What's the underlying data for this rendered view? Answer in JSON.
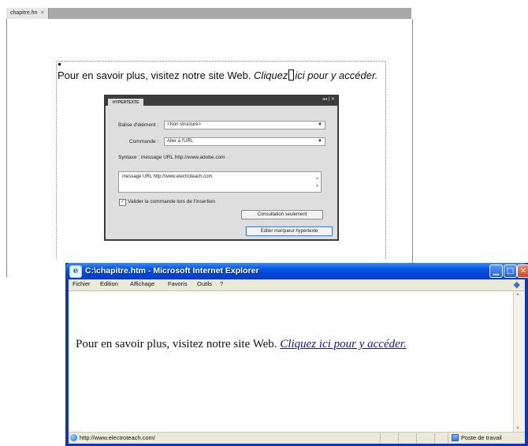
{
  "framemaker": {
    "tab_label": "chapitre.fm",
    "tab_close": "×",
    "sentence_plain": "Pour en savoir plus, visitez notre site Web. ",
    "link_part1": "Cliquez",
    "link_part2": "ici pour y accéder."
  },
  "hypertext_dialog": {
    "tab_label": "HYPERTEXTE",
    "header_controls": "◂◂ | ✕",
    "element_tag_label": "Balise d'élément :",
    "element_tag_value": "<Non structuré>",
    "command_label": "Commande :",
    "command_value": "Aller à l'URL",
    "syntax_label": "Syntaxe : message URL http://www.adobe.com",
    "syntax_value": "message URL http://www.electroteach.com",
    "validate_checked": "✓",
    "validate_label": "Valider la commande lors de l'insertion",
    "lookup_button": "Consultation seulement",
    "edit_button": "Editer marqueur hypertexte"
  },
  "ie_window": {
    "title": "C:\\chapitre.htm - Microsoft Internet Explorer",
    "min_icon": "▁",
    "max_icon": "□",
    "close_icon": "✕",
    "menu": [
      "Fichier",
      "Edition",
      "Affichage",
      "Favoris",
      "Outils",
      "?"
    ],
    "page_text": "Pour en savoir plus, visitez notre site Web. ",
    "page_link": "Cliquez ici pour  y accéder.",
    "status_url": "http://www.electroteach.com/",
    "status_zone": "Poste de travail"
  }
}
